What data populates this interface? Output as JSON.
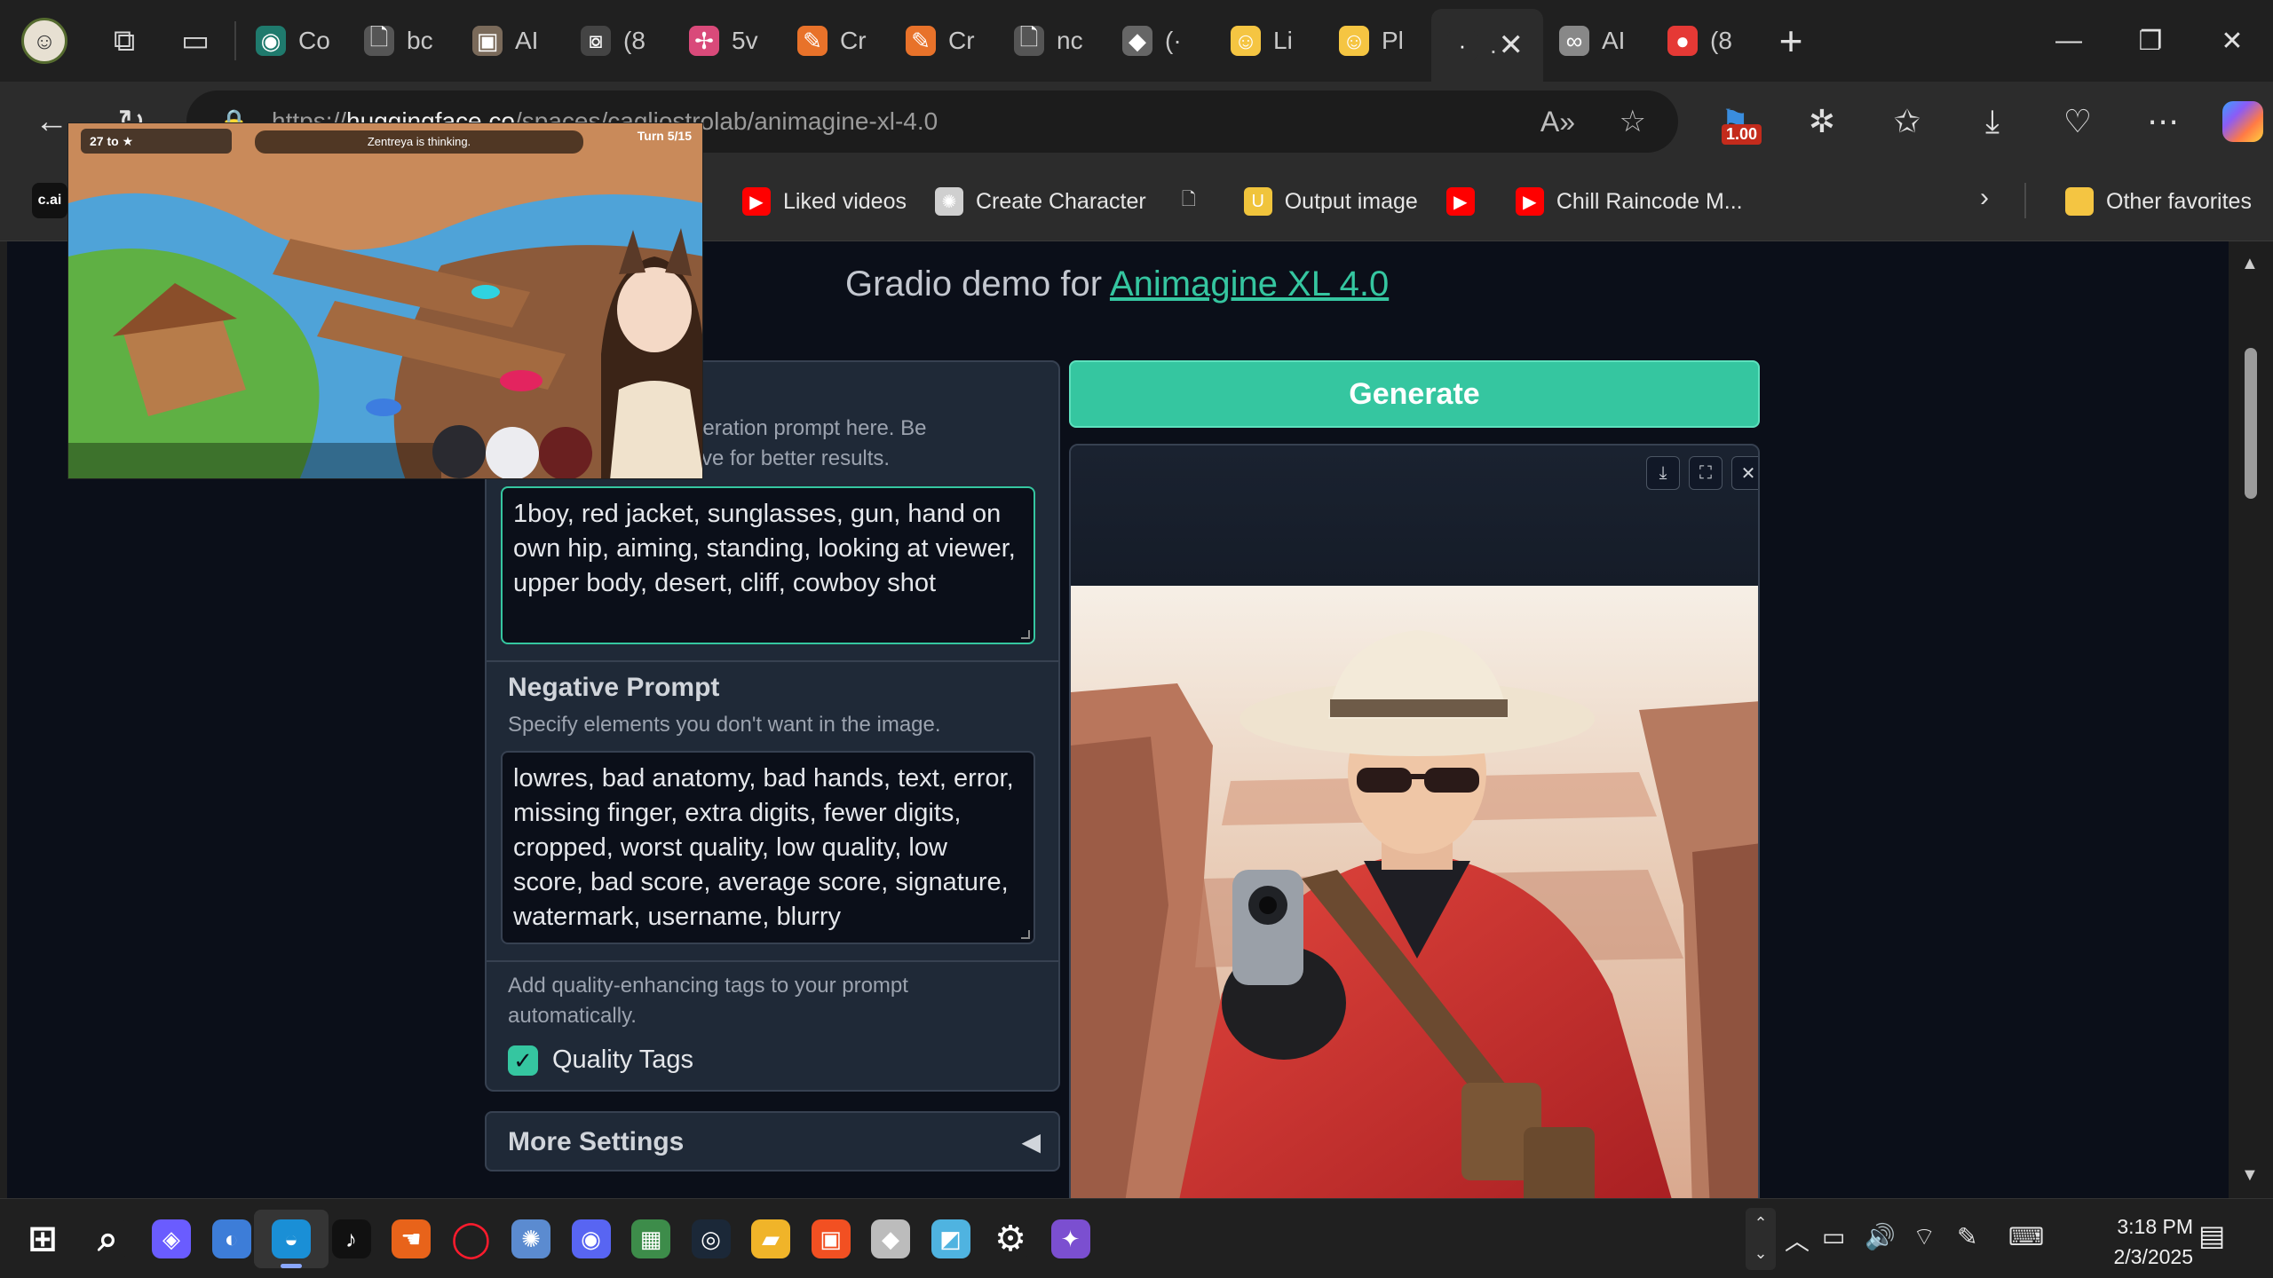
{
  "browser": {
    "tabs": [
      {
        "label": "Co",
        "icon": "globe-icon",
        "color": "#1f7a6d"
      },
      {
        "label": "bc",
        "icon": "document-icon",
        "color": "#555555"
      },
      {
        "label": "AI",
        "icon": "image-icon",
        "color": "#7a6a5a"
      },
      {
        "label": "(8",
        "icon": "gallery-icon",
        "color": "#444444"
      },
      {
        "label": "5v",
        "icon": "pinwheel-icon",
        "color": "#d94a7a"
      },
      {
        "label": "Cr",
        "icon": "pencil-icon",
        "color": "#e8722a"
      },
      {
        "label": "Cr",
        "icon": "pencil-icon",
        "color": "#e8722a"
      },
      {
        "label": "nc",
        "icon": "document-icon",
        "color": "#555555"
      },
      {
        "label": "(·",
        "icon": "cube-icon",
        "color": "#666666"
      },
      {
        "label": "Li",
        "icon": "smiley-icon",
        "color": "#f5c542"
      },
      {
        "label": "Pl",
        "icon": "smiley-icon",
        "color": "#f5c542"
      },
      {
        "label": ".",
        "icon": "blank-icon",
        "color": "#2c2c2c",
        "active": true
      },
      {
        "label": "AI",
        "icon": "infinity-icon",
        "color": "#888888"
      },
      {
        "label": "(8",
        "icon": "reddit-icon",
        "color": "#e53935"
      }
    ],
    "address": {
      "scheme": "https://",
      "host": "huggingface.co",
      "path": "/spaces/cagliostrolab/animagine-xl-4.0"
    },
    "toolbar_badge": "1.00",
    "favorites": [
      {
        "label": "Liked videos",
        "icon": "youtube-icon"
      },
      {
        "label": "Create Character",
        "icon": "openai-icon"
      },
      {
        "label": "",
        "icon": "document-icon"
      },
      {
        "label": "Output image",
        "icon": "bookmark-u-icon"
      },
      {
        "label": "",
        "icon": "youtube-icon"
      },
      {
        "label": "Chill Raincode M...",
        "icon": "youtube-icon"
      }
    ],
    "other_favorites": "Other favorites",
    "favicon_cai": "c.ai"
  },
  "page": {
    "title_prefix": "Gradio demo for ",
    "title_link": "Animagine XL 4.0",
    "prompt_hint_line1": "neration prompt here. Be",
    "prompt_hint_line2": "tive for better results.",
    "prompt_value": "1boy, red jacket, sunglasses, gun, hand on own hip, aiming, standing, looking at viewer, upper body, desert, cliff, cowboy shot",
    "negative_title": "Negative Prompt",
    "negative_hint": "Specify elements you don't want in the image.",
    "negative_value": "lowres, bad anatomy, bad hands, text, error, missing finger, extra digits, fewer digits, cropped, worst quality, low quality, low score, bad score, average score, signature, watermark, username, blurry",
    "quality_hint": "Add quality-enhancing tags to your prompt automatically.",
    "quality_label": "Quality Tags",
    "quality_checked": true,
    "more_settings": "More Settings",
    "generate_label": "Generate",
    "accent_color": "#35c6a0"
  },
  "pip": {
    "score_label": "27 to",
    "status": "Zentreya is thinking.",
    "turn_label": "Turn",
    "turn_value": "5/15"
  },
  "taskbar": {
    "time": "3:18 PM",
    "date": "2/3/2025",
    "apps": [
      "windows-start-icon",
      "search-icon",
      "copilot-icon",
      "colorful-app-icon",
      "edge-icon",
      "tiktok-icon",
      "hand-app-icon",
      "opera-icon",
      "paint-app-icon",
      "discord-icon",
      "image-app-icon",
      "steam-icon",
      "file-explorer-icon",
      "microsoft-store-icon",
      "cube-app-icon",
      "remote-app-icon",
      "settings-icon",
      "game-app-icon"
    ]
  }
}
